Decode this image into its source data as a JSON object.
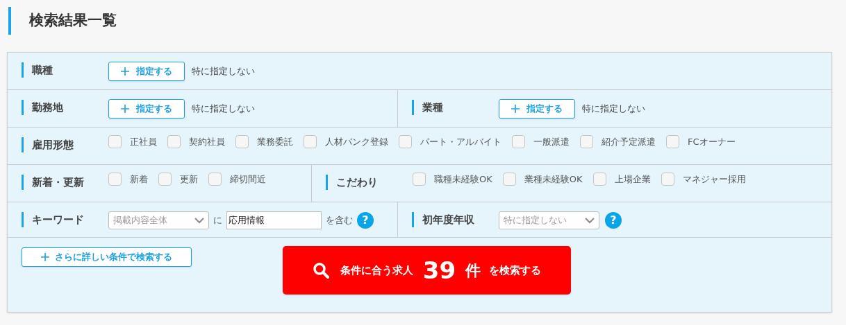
{
  "page_title": "検索結果一覧",
  "rows": [
    [
      {
        "kind": "specify",
        "label": "職種",
        "button": "指定する",
        "value": "特に指定しない"
      }
    ],
    [
      {
        "kind": "specify",
        "label": "勤務地",
        "button": "指定する",
        "value": "特に指定しない"
      },
      {
        "kind": "specify",
        "label": "業種",
        "button": "指定する",
        "value": "特に指定しない"
      }
    ],
    [
      {
        "kind": "checkboxes",
        "label": "雇用形態",
        "options": [
          {
            "label": "正社員",
            "checked": false
          },
          {
            "label": "契約社員",
            "checked": false
          },
          {
            "label": "業務委託",
            "checked": false
          },
          {
            "label": "人材バンク登録",
            "checked": false
          },
          {
            "label": "パート・アルバイト",
            "checked": false
          },
          {
            "label": "一般派遣",
            "checked": false
          },
          {
            "label": "紹介予定派遣",
            "checked": false
          },
          {
            "label": "FCオーナー",
            "checked": false
          }
        ]
      }
    ],
    [
      {
        "kind": "checkboxes",
        "label": "新着・更新",
        "options": [
          {
            "label": "新着",
            "checked": false
          },
          {
            "label": "更新",
            "checked": false
          },
          {
            "label": "締切間近",
            "checked": false
          }
        ]
      },
      {
        "kind": "checkboxes",
        "label": "こだわり",
        "options": [
          {
            "label": "職種未経験OK",
            "checked": false
          },
          {
            "label": "業種未経験OK",
            "checked": false
          },
          {
            "label": "上場企業",
            "checked": false
          },
          {
            "label": "マネジャー採用",
            "checked": false
          }
        ]
      }
    ],
    [
      {
        "kind": "keyword",
        "label": "キーワード",
        "select": "掲載内容全体",
        "connector": "に",
        "input": "応用情報",
        "suffix": "を含む",
        "help": "?"
      },
      {
        "kind": "select",
        "label": "初年度年収",
        "select": "特に指定しない",
        "help": "?"
      }
    ]
  ],
  "more_button": "さらに詳しい条件で検索する",
  "search_button": {
    "prefix": "条件に合う求人",
    "count": "39",
    "unit": "件",
    "suffix": "を検索する"
  }
}
